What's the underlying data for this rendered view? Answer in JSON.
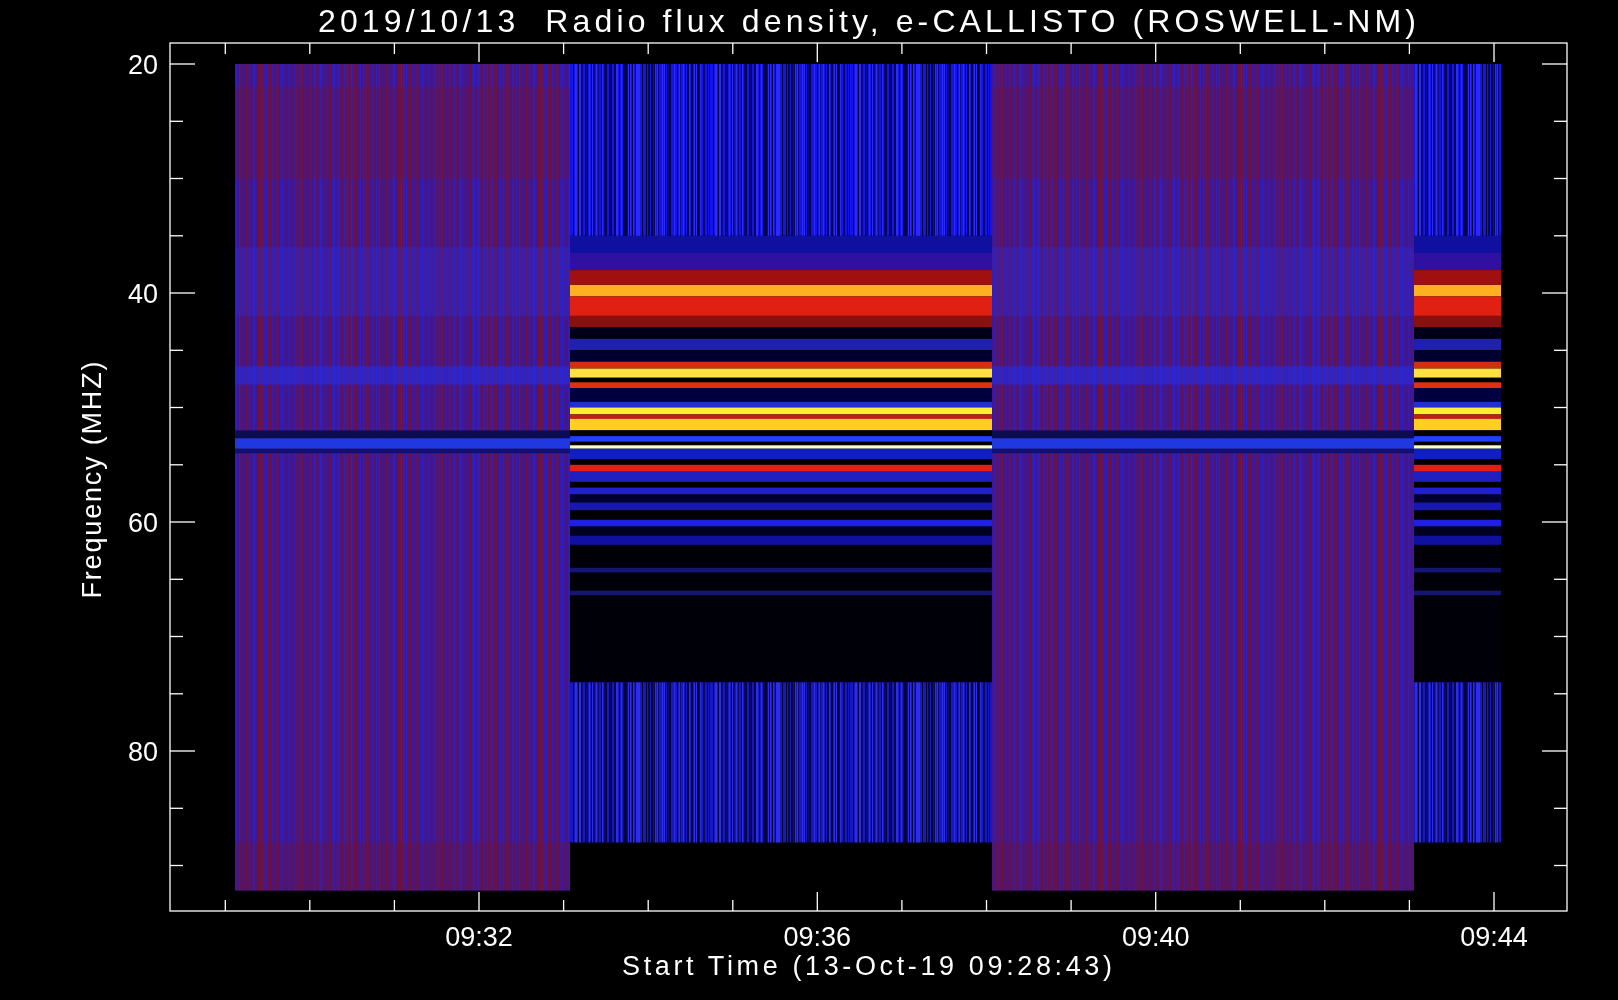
{
  "plot": {
    "title": "2019/10/13  Radio flux density, e-CALLISTO (ROSWELL-NM)",
    "ylabel": "Frequency (MHZ)",
    "xlabel": "Start Time (13-Oct-19 09:28:43)",
    "yticks": [
      "20",
      "40",
      "60",
      "80"
    ],
    "xticks": [
      "09:32",
      "09:36",
      "09:40",
      "09:44"
    ]
  }
}
